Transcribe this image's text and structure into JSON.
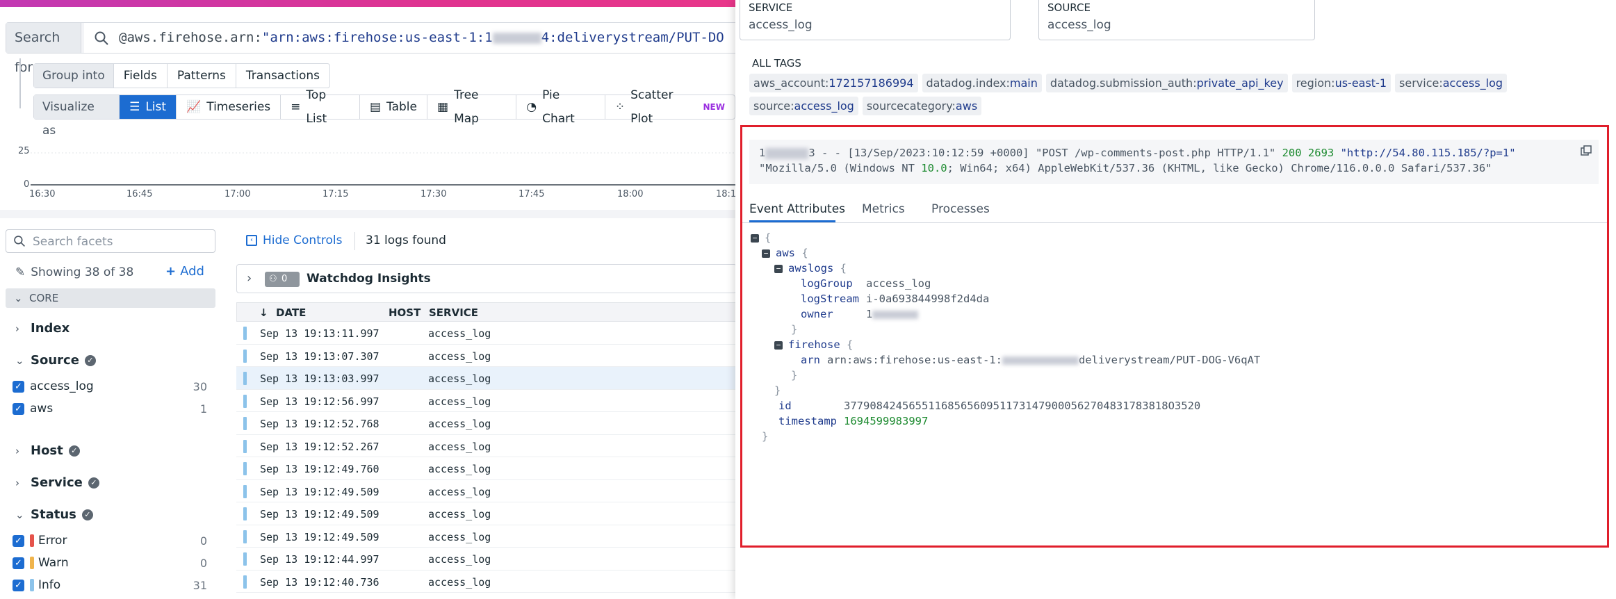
{
  "search": {
    "label": "Search for",
    "query_prefix": "@aws.firehose.arn:",
    "query_string_start": "\"arn:aws:firehose:us-east-1:1",
    "query_string_end": "4:deliverystream/PUT-DO"
  },
  "group_into": {
    "label": "Group into",
    "options": [
      "Fields",
      "Patterns",
      "Transactions"
    ]
  },
  "visualize_as": {
    "label": "Visualize as",
    "options": [
      {
        "label": "List",
        "icon": "list-icon",
        "active": true
      },
      {
        "label": "Timeseries",
        "icon": "timeseries-icon"
      },
      {
        "label": "Top List",
        "icon": "toplist-icon"
      },
      {
        "label": "Table",
        "icon": "table-icon"
      },
      {
        "label": "Tree Map",
        "icon": "treemap-icon"
      },
      {
        "label": "Pie Chart",
        "icon": "piechart-icon"
      },
      {
        "label": "Scatter Plot",
        "icon": "scatterplot-icon",
        "badge": "NEW"
      }
    ]
  },
  "chart": {
    "y_ticks": [
      "25",
      "0"
    ],
    "x_ticks": [
      "16:30",
      "16:45",
      "17:00",
      "17:15",
      "17:30",
      "17:45",
      "18:00",
      "18:1"
    ]
  },
  "facets": {
    "search_placeholder": "Search facets",
    "showing": "Showing 38 of 38",
    "add_label": "Add",
    "core_label": "CORE",
    "groups": {
      "index": "Index",
      "source": "Source",
      "host": "Host",
      "service": "Service",
      "status": "Status"
    },
    "source_items": [
      {
        "label": "access_log",
        "count": "30"
      },
      {
        "label": "aws",
        "count": "1"
      }
    ],
    "status_items": [
      {
        "label": "Error",
        "count": "0",
        "color": "#e5534b"
      },
      {
        "label": "Warn",
        "count": "0",
        "color": "#f0b44c"
      },
      {
        "label": "Info",
        "count": "31",
        "color": "#8cc3ea"
      }
    ]
  },
  "logs": {
    "hide_controls": "Hide Controls",
    "found": "31 logs found",
    "watchdog_count": "0",
    "watchdog_title": "Watchdog Insights",
    "columns": {
      "date": "DATE",
      "host": "HOST",
      "service": "SERVICE"
    },
    "rows": [
      {
        "date": "Sep 13 19:13:11.997",
        "service": "access_log"
      },
      {
        "date": "Sep 13 19:13:07.307",
        "service": "access_log"
      },
      {
        "date": "Sep 13 19:13:03.997",
        "service": "access_log",
        "selected": true
      },
      {
        "date": "Sep 13 19:12:56.997",
        "service": "access_log"
      },
      {
        "date": "Sep 13 19:12:52.768",
        "service": "access_log"
      },
      {
        "date": "Sep 13 19:12:52.267",
        "service": "access_log"
      },
      {
        "date": "Sep 13 19:12:49.760",
        "service": "access_log"
      },
      {
        "date": "Sep 13 19:12:49.509",
        "service": "access_log"
      },
      {
        "date": "Sep 13 19:12:49.509",
        "service": "access_log"
      },
      {
        "date": "Sep 13 19:12:49.509",
        "service": "access_log"
      },
      {
        "date": "Sep 13 19:12:44.997",
        "service": "access_log"
      },
      {
        "date": "Sep 13 19:12:40.736",
        "service": "access_log"
      }
    ]
  },
  "panel": {
    "service_key": "SERVICE",
    "service_value": "access_log",
    "source_key": "SOURCE",
    "source_value": "access_log",
    "all_tags_title": "ALL TAGS",
    "tags": [
      {
        "k": "aws_account:",
        "v": "172157186994"
      },
      {
        "k": "datadog.index:",
        "v": "main"
      },
      {
        "k": "datadog.submission_auth:",
        "v": "private_api_key"
      },
      {
        "k": "region:",
        "v": "us-east-1"
      },
      {
        "k": "service:",
        "v": "access_log"
      },
      {
        "k": "source:",
        "v": "access_log"
      },
      {
        "k": "sourcecategory:",
        "v": "aws"
      }
    ],
    "raw": {
      "ip_start": "1",
      "ip_end": "3",
      "line1_mid": " - - [13/Sep/2023:10:12:59 +0000] \"POST /wp-comments-post.php HTTP/1.1\" ",
      "status": "200",
      "size": "2693",
      "url": "\"http://54.80.115.185/?p=1\"",
      "line2_a": "\"Mozilla/5.0 (Windows NT ",
      "line2_ver": "10.0",
      "line2_b": "; Win64; x64) AppleWebKit/537.36 (KHTML, like Gecko) Chrome/116.0.0.0 Safari/537.36\""
    },
    "tabs": [
      "Event Attributes",
      "Metrics",
      "Processes"
    ],
    "attrs": {
      "aws": "aws",
      "awslogs": "awslogs",
      "logGroup_k": "logGroup",
      "logGroup_v": "access_log",
      "logStream_k": "logStream",
      "logStream_v": "i-0a693844998f2d4da",
      "owner_k": "owner",
      "owner_v": "1",
      "firehose": "firehose",
      "arn_k": "arn",
      "arn_v_start": "arn:aws:firehose:us-east-1:",
      "arn_v_end": "deliverystream/PUT-DOG-V6qAT",
      "id_k": "id",
      "id_v": "37790842456551168565609511731479000562704831783818O3520",
      "timestamp_k": "timestamp",
      "timestamp_v": "1694599983997"
    }
  }
}
